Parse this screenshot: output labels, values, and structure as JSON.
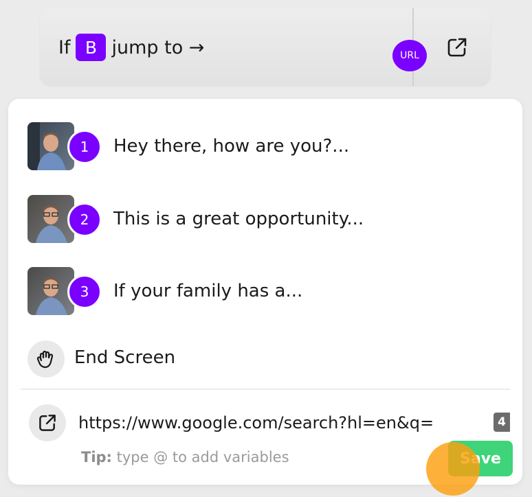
{
  "topbar": {
    "prefix": "If",
    "letter": "B",
    "suffix": "jump to →",
    "url_badge": "URL"
  },
  "steps": [
    {
      "number": "1",
      "label": "Hey there, how are you?..."
    },
    {
      "number": "2",
      "label": "This is a great opportunity..."
    },
    {
      "number": "3",
      "label": "If your family has a..."
    }
  ],
  "end_screen": {
    "label": "End Screen"
  },
  "url_field": {
    "value": "https://www.google.com/search?hl=en&q=",
    "overflow_char": "4"
  },
  "tip": {
    "bold": "Tip:",
    "text": " type @ to add variables"
  },
  "save": {
    "label": "Save"
  },
  "colors": {
    "accent": "#7a00ff",
    "save": "#3fd47a",
    "cursor": "#fca00f"
  }
}
